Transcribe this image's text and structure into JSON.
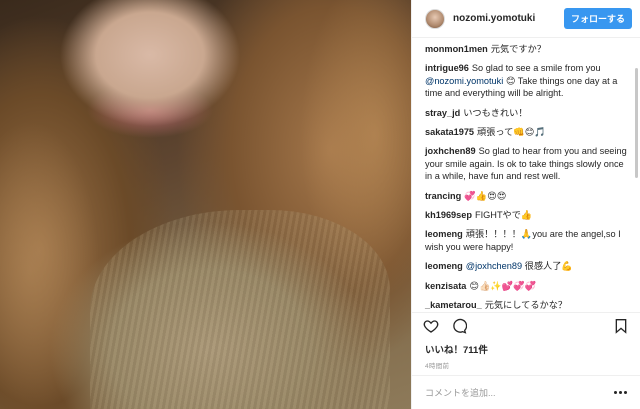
{
  "post": {
    "image_alt": "selfie"
  },
  "header": {
    "username": "nozomi.yomotuki",
    "follow_label": "フォローする"
  },
  "comments": [
    {
      "user": "monmon1men",
      "text": "元気ですか？"
    },
    {
      "user": "intrigue96",
      "text": "So glad to see a smile from you",
      "mention": "@nozomi.yomotuki",
      "rest": " 😊  Take things one day at a time and everything will be alright."
    },
    {
      "user": "stray_jd",
      "text": "いつもきれい！"
    },
    {
      "user": "sakata1975",
      "text": "頑張って👊😊🎵"
    },
    {
      "user": "joxhchen89",
      "text": "So glad to hear from you and seeing your smile again. Is ok to take things slowly once in a while, have fun and rest well."
    },
    {
      "user": "trancing",
      "text": "💞👍😍😍"
    },
    {
      "user": "kh1969sep",
      "text": "FIGHTやで👍"
    },
    {
      "user": "leomeng",
      "text": "頑張！！！！🙏you are the angel,so I wish you were happy!"
    },
    {
      "user": "leomeng",
      "text": "",
      "mention": "@joxhchen89",
      "rest": " 很感人了💪"
    },
    {
      "user": "kenzisata",
      "text": "😊👍🏻✨💕💞💞"
    },
    {
      "user": "_kametarou_",
      "text": "元気にしてるかな？"
    }
  ],
  "actions": {
    "like_icon": "heart-icon",
    "comment_icon": "comment-icon",
    "save_icon": "bookmark-icon"
  },
  "likes_text": "いいね！711件",
  "time_text": "4時間前",
  "add_comment_placeholder": "コメントを追加..."
}
